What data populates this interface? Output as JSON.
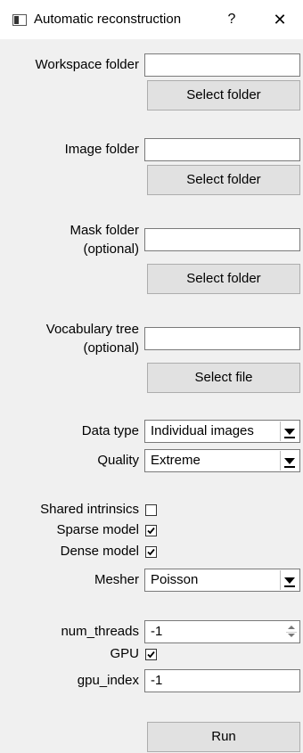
{
  "window": {
    "title": "Automatic reconstruction",
    "help_label": "?",
    "close_label": "✕"
  },
  "workspace": {
    "label": "Workspace folder",
    "value": "",
    "button": "Select folder"
  },
  "image": {
    "label": "Image folder",
    "value": "",
    "button": "Select folder"
  },
  "mask": {
    "label_line1": "Mask folder",
    "label_line2": "(optional)",
    "value": "",
    "button": "Select folder"
  },
  "vocab": {
    "label_line1": "Vocabulary tree",
    "label_line2": "(optional)",
    "value": "",
    "button": "Select file"
  },
  "data_type": {
    "label": "Data type",
    "selected": "Individual images"
  },
  "quality": {
    "label": "Quality",
    "selected": "Extreme"
  },
  "shared_intrinsics": {
    "label": "Shared intrinsics",
    "checked": false
  },
  "sparse_model": {
    "label": "Sparse model",
    "checked": true
  },
  "dense_model": {
    "label": "Dense model",
    "checked": true
  },
  "mesher": {
    "label": "Mesher",
    "selected": "Poisson"
  },
  "num_threads": {
    "label": "num_threads",
    "value": "-1"
  },
  "gpu": {
    "label": "GPU",
    "checked": true
  },
  "gpu_index": {
    "label": "gpu_index",
    "value": "-1"
  },
  "run_button": "Run"
}
